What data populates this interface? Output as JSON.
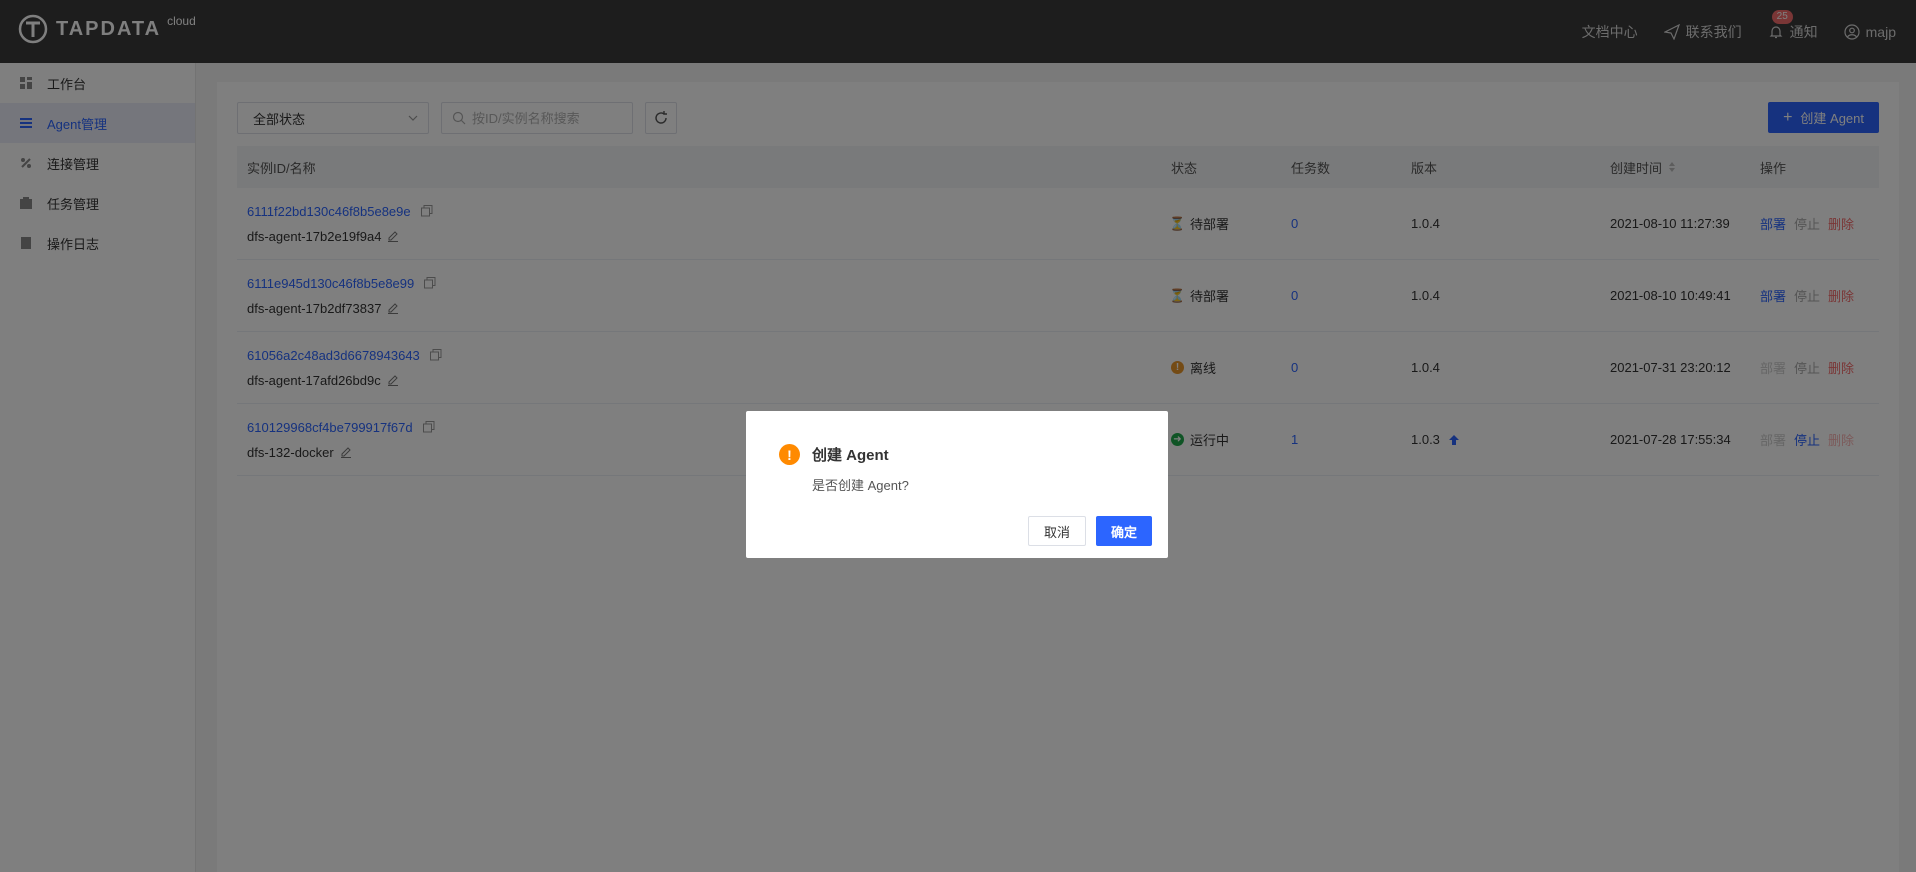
{
  "brand": {
    "name": "TAPDATA",
    "sub": "cloud"
  },
  "topnav": {
    "docs": "文档中心",
    "contact": "联系我们",
    "notify_label": "通知",
    "notify_count": "25",
    "user": "majp"
  },
  "sidebar": {
    "items": [
      {
        "label": "工作台",
        "icon": "dashboard-icon"
      },
      {
        "label": "Agent管理",
        "icon": "list-icon",
        "active": true
      },
      {
        "label": "连接管理",
        "icon": "link-icon"
      },
      {
        "label": "任务管理",
        "icon": "task-icon"
      },
      {
        "label": "操作日志",
        "icon": "log-icon"
      }
    ]
  },
  "toolbar": {
    "status_select": "全部状态",
    "search_placeholder": "按ID/实例名称搜索",
    "create_label": "创建 Agent"
  },
  "table": {
    "headers": [
      "实例ID/名称",
      "状态",
      "任务数",
      "版本",
      "创建时间",
      "操作"
    ],
    "ops": {
      "deploy": "部署",
      "stop": "停止",
      "delete": "删除"
    },
    "rows": [
      {
        "id": "6111f22bd130c46f8b5e8e9e",
        "name": "dfs-agent-17b2e19f9a4",
        "status": "待部署",
        "status_kind": "pending",
        "tasks": "0",
        "version": "1.0.4",
        "created": "2021-08-10 11:27:39"
      },
      {
        "id": "6111e945d130c46f8b5e8e99",
        "name": "dfs-agent-17b2df73837",
        "status": "待部署",
        "status_kind": "pending",
        "tasks": "0",
        "version": "1.0.4",
        "created": "2021-08-10 10:49:41"
      },
      {
        "id": "61056a2c48ad3d6678943643",
        "name": "dfs-agent-17afd26bd9c",
        "status": "离线",
        "status_kind": "offline",
        "tasks": "0",
        "version": "1.0.4",
        "created": "2021-07-31 23:20:12"
      },
      {
        "id": "610129968cf4be799917f67d",
        "name": "dfs-132-docker",
        "status": "运行中",
        "status_kind": "running",
        "tasks": "1",
        "version": "1.0.3",
        "upgrade": true,
        "created": "2021-07-28 17:55:34"
      }
    ]
  },
  "dialog": {
    "title": "创建 Agent",
    "message": "是否创建 Agent?",
    "cancel": "取消",
    "confirm": "确定"
  },
  "colors": {
    "accent": "#2c65ff",
    "warning": "#ff8a00",
    "danger": "#f56c6c",
    "success": "#1fa84a"
  }
}
